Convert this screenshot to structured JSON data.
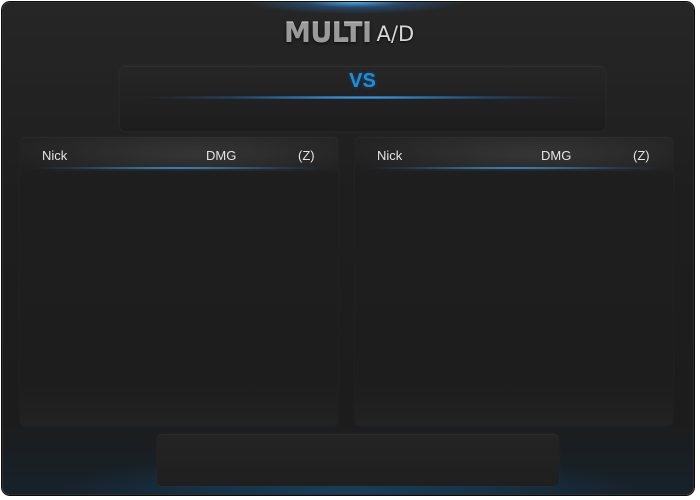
{
  "title": {
    "primary": "MULTI",
    "secondary": "A/D"
  },
  "versus": {
    "label": "VS"
  },
  "teams": [
    {
      "columns": {
        "nick": "Nick",
        "dmg": "DMG",
        "z": "(Z)"
      },
      "rows": []
    },
    {
      "columns": {
        "nick": "Nick",
        "dmg": "DMG",
        "z": "(Z)"
      },
      "rows": []
    }
  ],
  "colors": {
    "accent": "#1a8fe0",
    "background": "#1e1e1e",
    "text": "#e4e4e4"
  }
}
